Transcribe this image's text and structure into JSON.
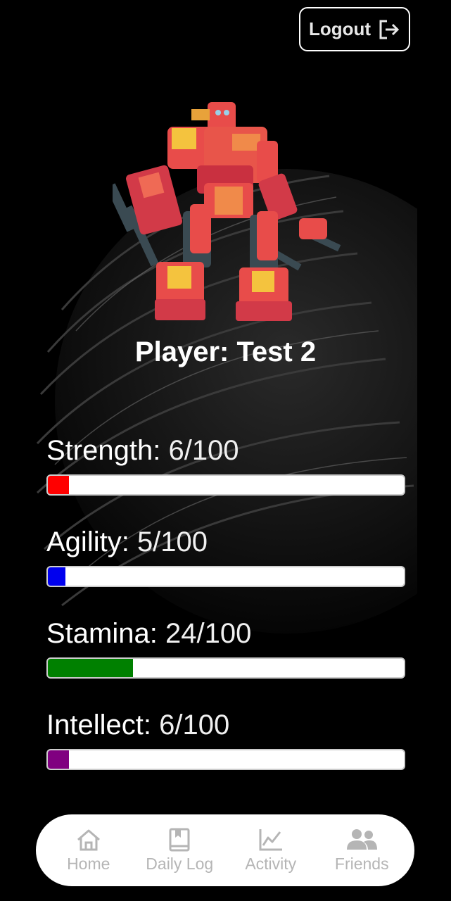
{
  "header": {
    "logout_label": "Logout",
    "logout_icon": "logout-icon"
  },
  "avatar": {
    "icon": "robot-icon"
  },
  "player": {
    "title": "Player: Test 2"
  },
  "stats": [
    {
      "label": "Strength:",
      "value": "6/100",
      "fraction": 0.06,
      "color": "#ff0000"
    },
    {
      "label": "Agility:",
      "value": "5/100",
      "fraction": 0.05,
      "color": "#0000ee"
    },
    {
      "label": "Stamina:",
      "value": "24/100",
      "fraction": 0.24,
      "color": "#008000"
    },
    {
      "label": "Intellect:",
      "value": "6/100",
      "fraction": 0.06,
      "color": "#800080"
    }
  ],
  "nav": {
    "items": [
      {
        "label": "Home",
        "icon": "home-icon"
      },
      {
        "label": "Daily Log",
        "icon": "book-icon"
      },
      {
        "label": "Activity",
        "icon": "chart-line-icon"
      },
      {
        "label": "Friends",
        "icon": "users-icon"
      }
    ]
  }
}
